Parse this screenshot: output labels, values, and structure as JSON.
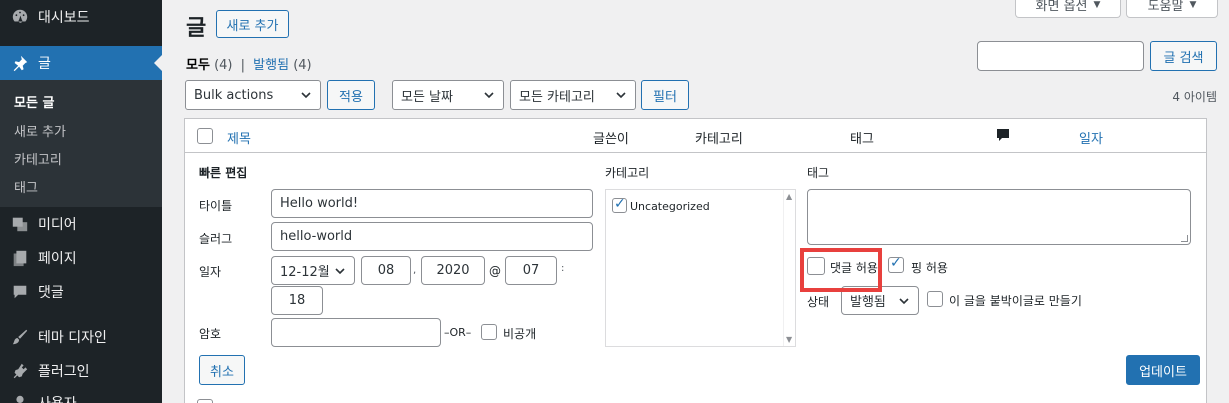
{
  "sidebar": {
    "dashboard": "대시보드",
    "posts": "글",
    "submenu": [
      "모든 글",
      "새로 추가",
      "카테고리",
      "태그"
    ],
    "media": "미디어",
    "pages": "페이지",
    "comments": "댓글",
    "appearance": "테마 디자인",
    "plugins": "플러그인",
    "users": "사용자"
  },
  "header": {
    "title": "글",
    "add_new": "새로 추가",
    "screen_options": "화면 옵션",
    "help": "도움말"
  },
  "filters": {
    "all": "모두",
    "all_count": "(4)",
    "separator": "|",
    "published": "발행됨",
    "published_count": "(4)",
    "bulk_actions": "Bulk actions",
    "apply": "적용",
    "all_dates": "모든 날짜",
    "all_categories": "모든 카테고리",
    "filter": "필터",
    "search_button": "글 검색",
    "search_value": "",
    "items_count": "4 아이템"
  },
  "table": {
    "col_title": "제목",
    "col_author": "글쓴이",
    "col_categories": "카테고리",
    "col_tags": "태그",
    "col_date": "일자"
  },
  "quick_edit": {
    "heading": "빠른 편집",
    "title_label": "타이틀",
    "title_value": "Hello world!",
    "slug_label": "슬러그",
    "slug_value": "hello-world",
    "date_label": "일자",
    "month_value": "12-12월",
    "day_value": "08",
    "date_comma": ",",
    "year_value": "2020",
    "at_symbol": "@",
    "hour_value": "07",
    "time_colon": ":",
    "minute_value": "18",
    "password_label": "암호",
    "password_value": "",
    "or_text": "–OR–",
    "private_label": "비공개",
    "categories_label": "카테고리",
    "category_item": "Uncategorized",
    "tags_label": "태그",
    "allow_comments": "댓글 허용",
    "allow_pings": "핑 허용",
    "status_label": "상태",
    "status_value": "발행됨",
    "sticky_label": "이 글을 붙박이글로 만들기",
    "cancel": "취소",
    "update": "업데이트"
  }
}
